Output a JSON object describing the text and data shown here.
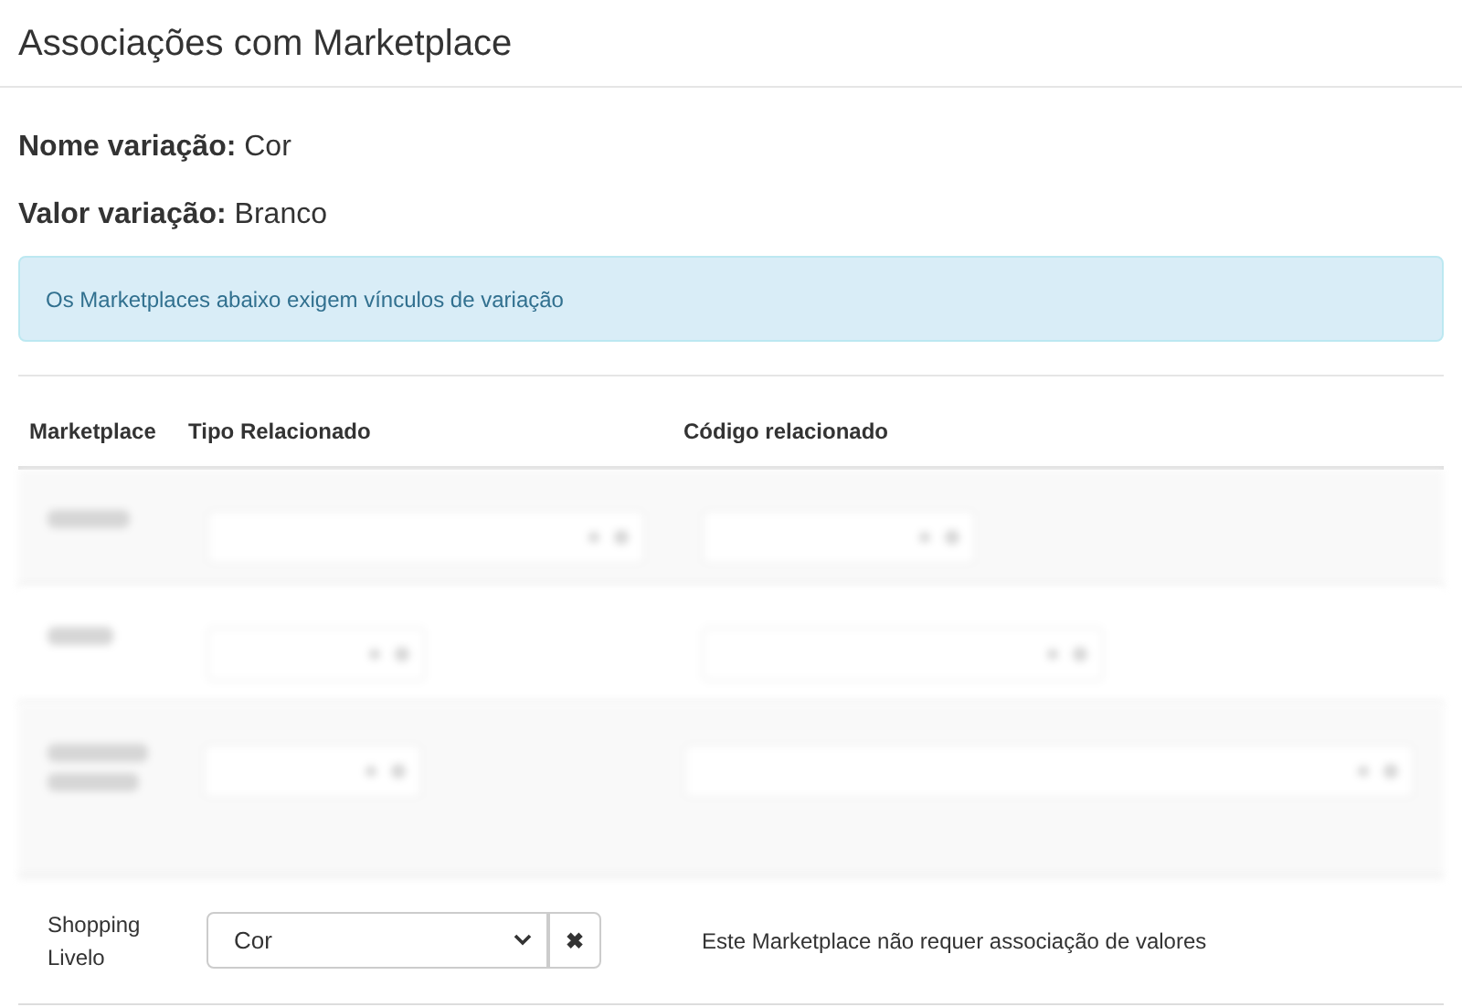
{
  "title": "Associações com Marketplace",
  "fields": [
    {
      "label": "Nome variação:",
      "value": "Cor"
    },
    {
      "label": "Valor variação:",
      "value": "Branco"
    }
  ],
  "alert": "Os Marketplaces abaixo exigem vínculos de variação",
  "table": {
    "columns": [
      "Marketplace",
      "Tipo Relacionado",
      "Código relacionado"
    ],
    "rows": [
      {
        "kind": "blurred"
      },
      {
        "kind": "blurred"
      },
      {
        "kind": "blurred"
      },
      {
        "kind": "normal",
        "marketplace": "Shopping Livelo",
        "type": "Cor",
        "remove": "✖",
        "code": "Este Marketplace não requer associação de valores"
      }
    ]
  }
}
